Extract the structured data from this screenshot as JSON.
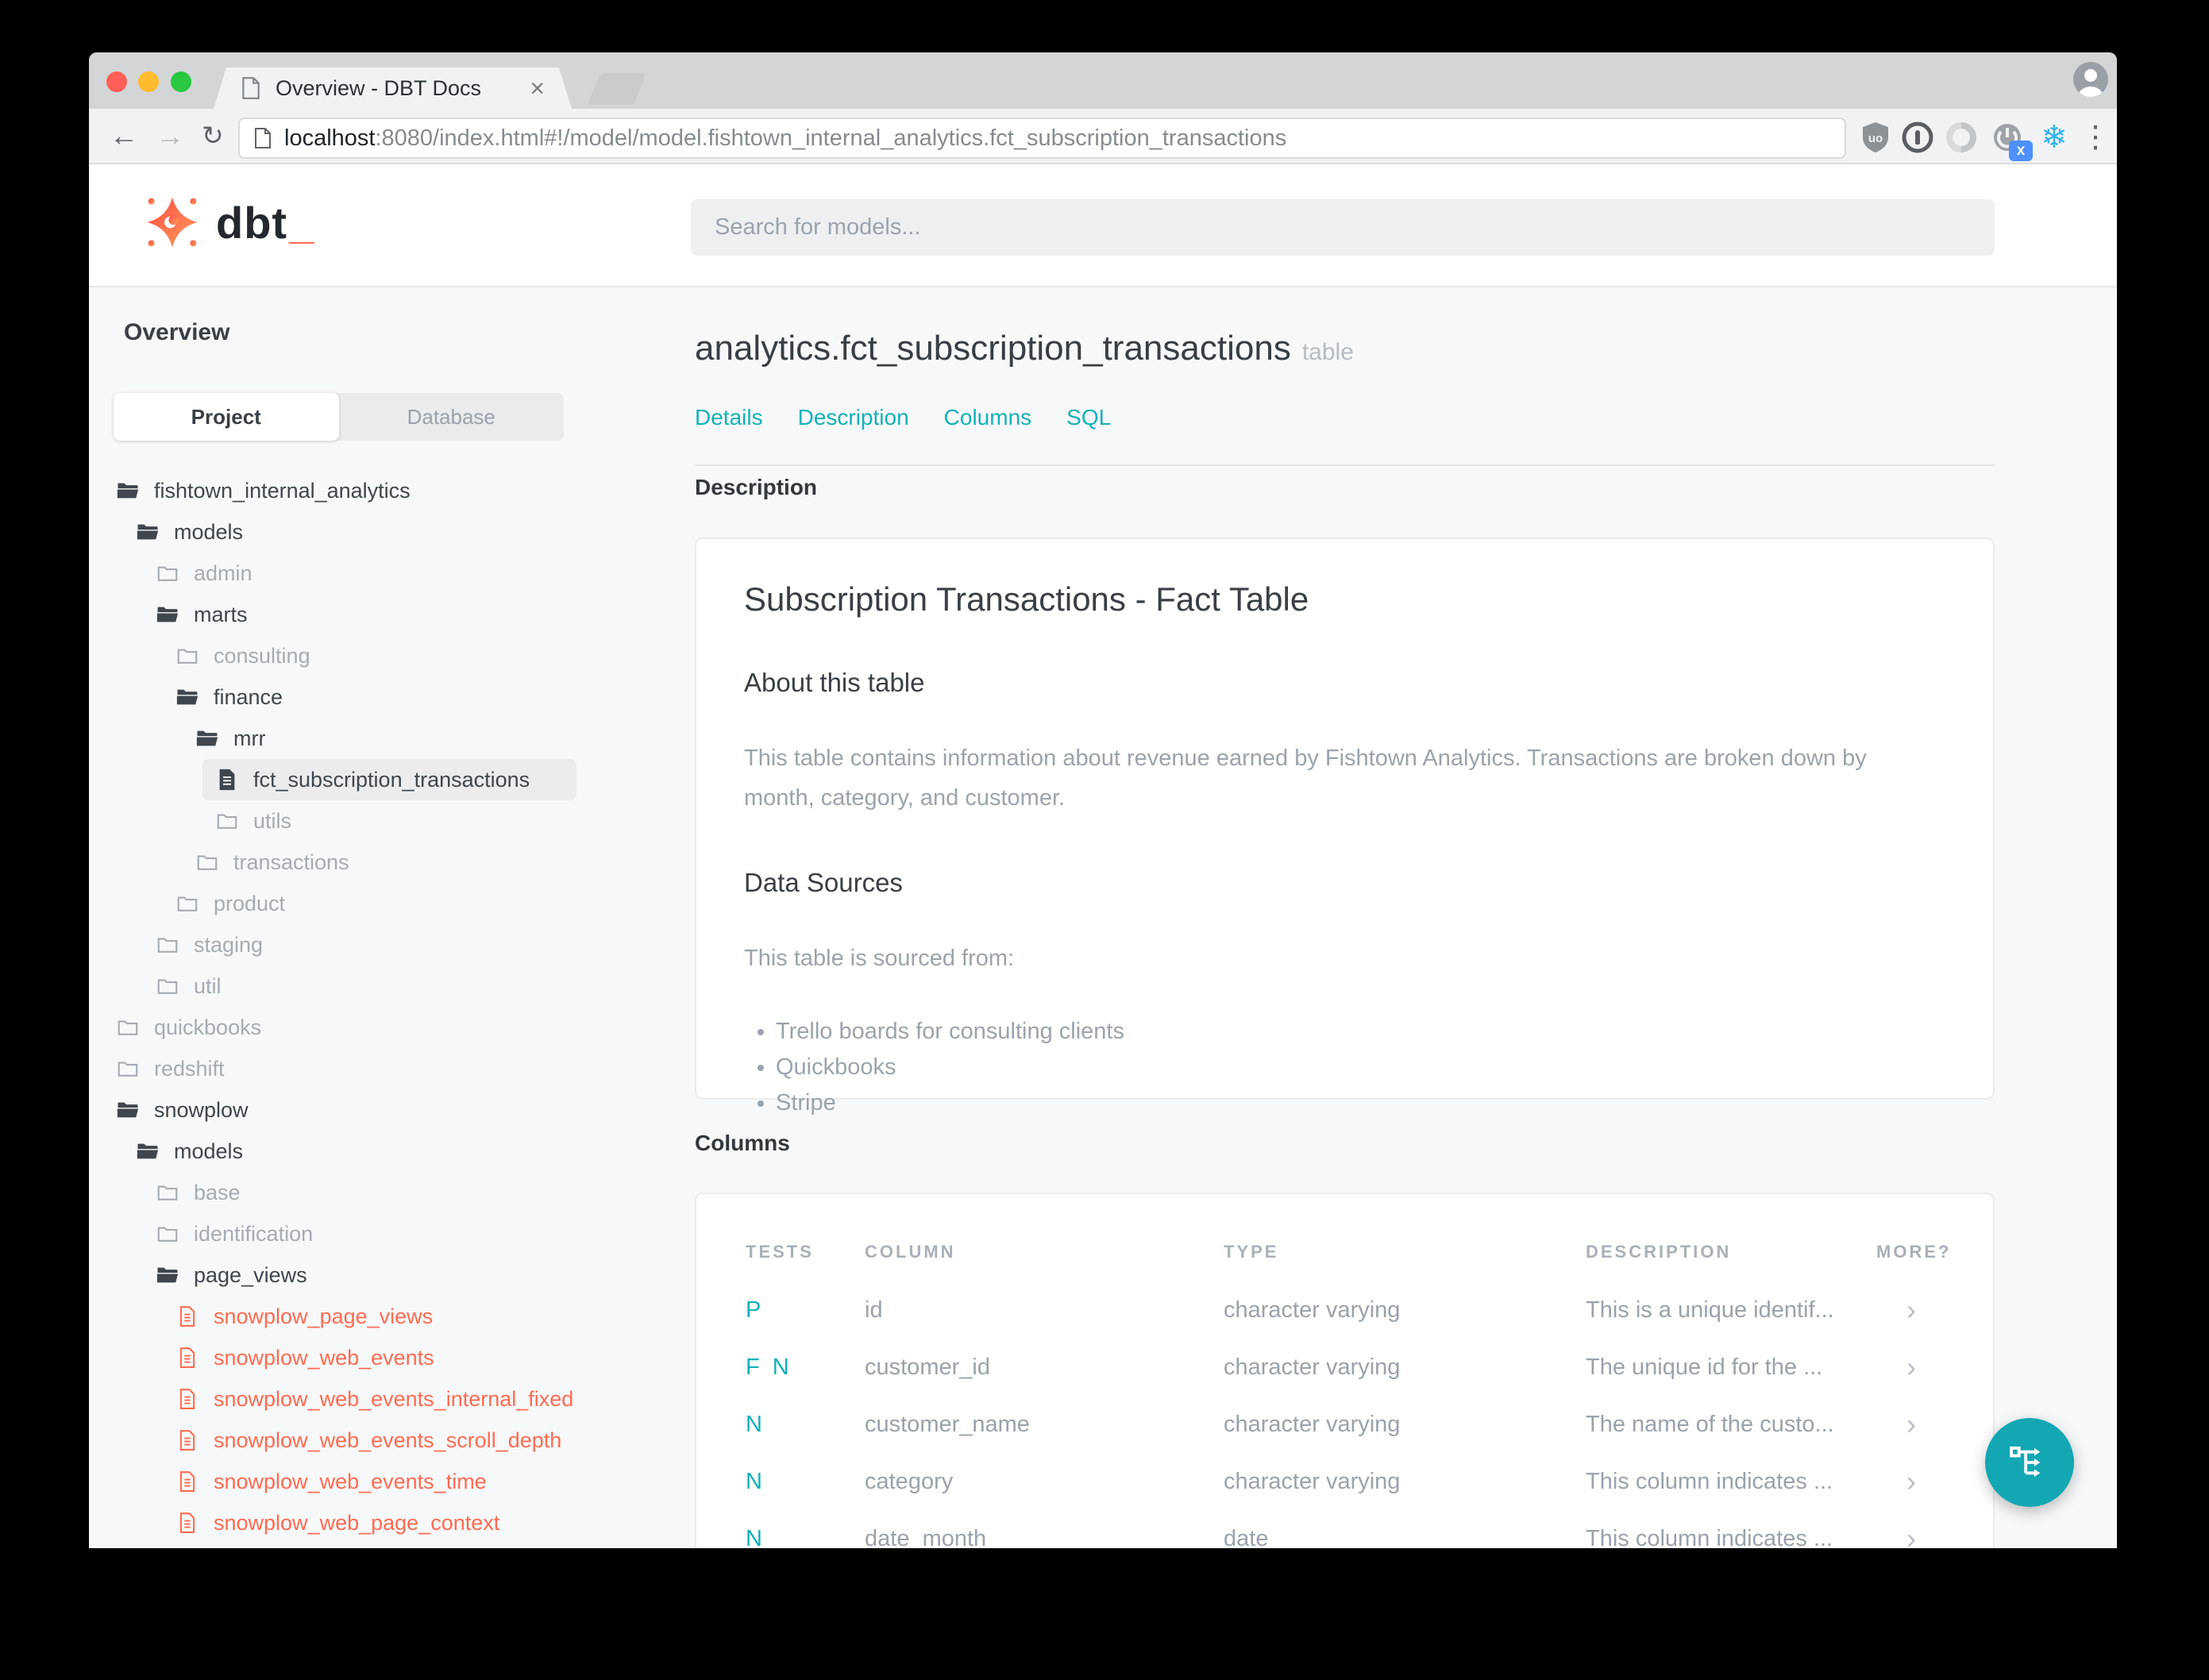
{
  "colors": {
    "accent_teal": "#14b1b7",
    "fab_teal": "#12a7b3",
    "brand_red": "#ff6b52"
  },
  "browser": {
    "tab": {
      "title": "Overview - DBT Docs",
      "close": "×"
    },
    "url": {
      "host": "localhost",
      "rest": ":8080/index.html#!/model/model.fishtown_internal_analytics.fct_subscription_transactions"
    },
    "toolbar": {
      "back": "←",
      "forward": "→",
      "refresh": "↻"
    },
    "extensions": {
      "ublock_letters": "uo",
      "power_badge": "x",
      "snowflake": "❄",
      "menu_dots": "⋮"
    }
  },
  "header": {
    "brand": "dbt",
    "brand_underscore": "_",
    "search_placeholder": "Search for models..."
  },
  "sidebar": {
    "title": "Overview",
    "tabs": [
      {
        "label": "Project",
        "active": true
      },
      {
        "label": "Database",
        "active": false
      }
    ],
    "tree": [
      {
        "label": "fishtown_internal_analytics",
        "depth": 0,
        "icon": "folder-open-icon",
        "variant": "dark"
      },
      {
        "label": "models",
        "depth": 1,
        "icon": "folder-open-icon",
        "variant": "dark"
      },
      {
        "label": "admin",
        "depth": 2,
        "icon": "folder-icon",
        "variant": "muted"
      },
      {
        "label": "marts",
        "depth": 2,
        "icon": "folder-open-icon",
        "variant": "dark"
      },
      {
        "label": "consulting",
        "depth": 3,
        "icon": "folder-icon",
        "variant": "muted"
      },
      {
        "label": "finance",
        "depth": 3,
        "icon": "folder-open-icon",
        "variant": "dark"
      },
      {
        "label": "mrr",
        "depth": 4,
        "icon": "folder-open-icon",
        "variant": "dark"
      },
      {
        "label": "fct_subscription_transactions",
        "depth": 5,
        "icon": "file-icon",
        "variant": "dark",
        "selected": true
      },
      {
        "label": "utils",
        "depth": 5,
        "icon": "folder-icon",
        "variant": "muted"
      },
      {
        "label": "transactions",
        "depth": 4,
        "icon": "folder-icon",
        "variant": "muted"
      },
      {
        "label": "product",
        "depth": 3,
        "icon": "folder-icon",
        "variant": "muted"
      },
      {
        "label": "staging",
        "depth": 2,
        "icon": "folder-icon",
        "variant": "muted"
      },
      {
        "label": "util",
        "depth": 2,
        "icon": "folder-icon",
        "variant": "muted"
      },
      {
        "label": "quickbooks",
        "depth": 0,
        "icon": "folder-icon",
        "variant": "muted"
      },
      {
        "label": "redshift",
        "depth": 0,
        "icon": "folder-icon",
        "variant": "muted"
      },
      {
        "label": "snowplow",
        "depth": 0,
        "icon": "folder-open-icon",
        "variant": "dark"
      },
      {
        "label": "models",
        "depth": 1,
        "icon": "folder-open-icon",
        "variant": "dark"
      },
      {
        "label": "base",
        "depth": 2,
        "icon": "folder-icon",
        "variant": "muted"
      },
      {
        "label": "identification",
        "depth": 2,
        "icon": "folder-icon",
        "variant": "muted"
      },
      {
        "label": "page_views",
        "depth": 2,
        "icon": "folder-open-icon",
        "variant": "dark"
      },
      {
        "label": "snowplow_page_views",
        "depth": 3,
        "icon": "file-outline-icon",
        "variant": "red"
      },
      {
        "label": "snowplow_web_events",
        "depth": 3,
        "icon": "file-outline-icon",
        "variant": "red"
      },
      {
        "label": "snowplow_web_events_internal_fixed",
        "depth": 3,
        "icon": "file-outline-icon",
        "variant": "red"
      },
      {
        "label": "snowplow_web_events_scroll_depth",
        "depth": 3,
        "icon": "file-outline-icon",
        "variant": "red"
      },
      {
        "label": "snowplow_web_events_time",
        "depth": 3,
        "icon": "file-outline-icon",
        "variant": "red"
      },
      {
        "label": "snowplow_web_page_context",
        "depth": 3,
        "icon": "file-outline-icon",
        "variant": "red"
      }
    ]
  },
  "main": {
    "title": "analytics.fct_subscription_transactions",
    "title_suffix": "table",
    "nav": [
      "Details",
      "Description",
      "Columns",
      "SQL"
    ],
    "description_section": {
      "label": "Description",
      "card": {
        "title": "Subscription Transactions - Fact Table",
        "about_heading": "About this table",
        "about_text": "This table contains information about revenue earned by Fishtown Analytics. Transactions are broken down by month, category, and customer.",
        "sources_heading": "Data Sources",
        "sources_intro": "This table is sourced from:",
        "sources": [
          "Trello boards for consulting clients",
          "Quickbooks",
          "Stripe"
        ]
      }
    },
    "columns_section": {
      "label": "Columns",
      "headers": [
        "TESTS",
        "COLUMN",
        "TYPE",
        "DESCRIPTION",
        "MORE?"
      ],
      "rows": [
        {
          "tests": "P",
          "column": "id",
          "type": "character varying",
          "description": "This is a unique identif...",
          "more": "›"
        },
        {
          "tests": "F N",
          "column": "customer_id",
          "type": "character varying",
          "description": "The unique id for the ...",
          "more": "›"
        },
        {
          "tests": "N",
          "column": "customer_name",
          "type": "character varying",
          "description": "The name of the custo...",
          "more": "›"
        },
        {
          "tests": "N",
          "column": "category",
          "type": "character varying",
          "description": "This column indicates ...",
          "more": "›"
        },
        {
          "tests": "N",
          "column": "date_month",
          "type": "date",
          "description": "This column indicates ...",
          "more": "›"
        }
      ]
    }
  }
}
